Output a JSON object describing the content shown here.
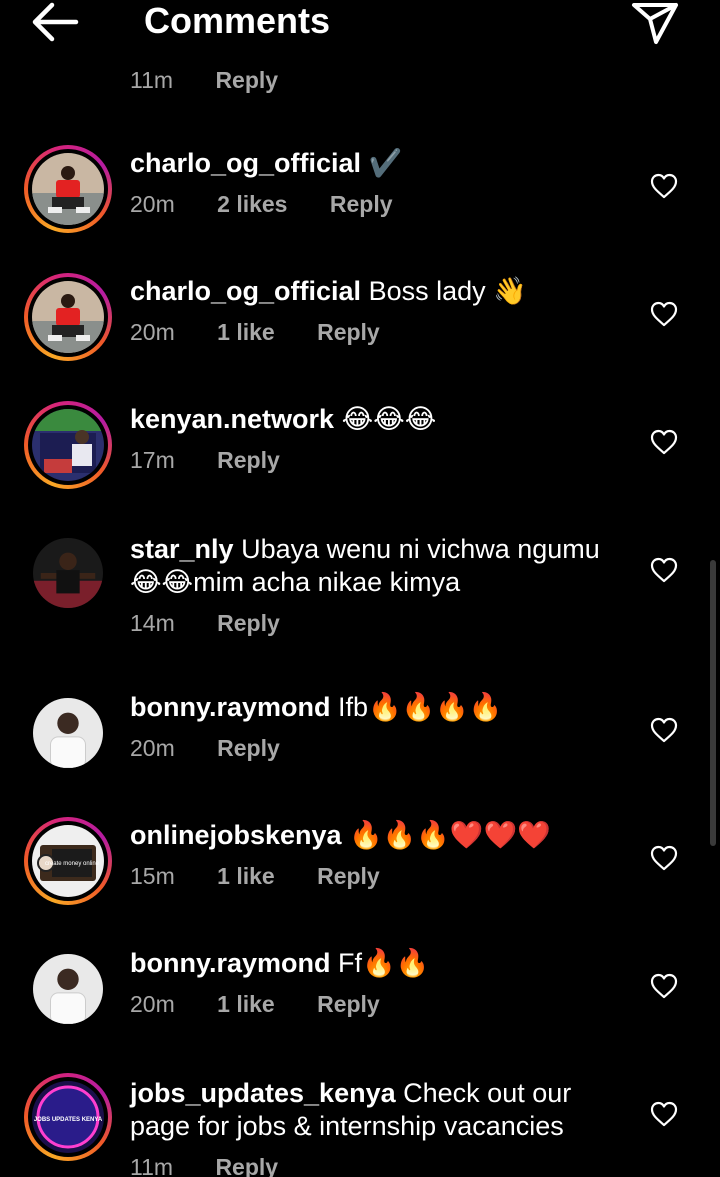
{
  "header": {
    "title": "Comments"
  },
  "top_partial": {
    "time": "11m",
    "reply": "Reply"
  },
  "comments": [
    {
      "username": "charlo_og_official",
      "text": "✔️",
      "time": "20m",
      "likes": "2 likes",
      "reply": "Reply"
    },
    {
      "username": "charlo_og_official",
      "text": "Boss lady 👋",
      "time": "20m",
      "likes": "1 like",
      "reply": "Reply"
    },
    {
      "username": "kenyan.network",
      "text": "😂😂😂",
      "time": "17m",
      "likes": "",
      "reply": "Reply"
    },
    {
      "username": "star_nly",
      "text": "Ubaya wenu ni vichwa  ngumu 😂😂mim acha nikae kimya",
      "time": "14m",
      "likes": "",
      "reply": "Reply"
    },
    {
      "username": "bonny.raymond",
      "text": "Ifb🔥🔥🔥🔥",
      "time": "20m",
      "likes": "",
      "reply": "Reply"
    },
    {
      "username": "onlinejobskenya",
      "text": "🔥🔥🔥❤️❤️❤️",
      "time": "15m",
      "likes": "1 like",
      "reply": "Reply"
    },
    {
      "username": "bonny.raymond",
      "text": "Ff🔥🔥",
      "time": "20m",
      "likes": "1 like",
      "reply": "Reply"
    },
    {
      "username": "jobs_updates_kenya",
      "text": "Check out our page for jobs & internship vacancies",
      "time": "11m",
      "likes": "",
      "reply": "Reply"
    }
  ],
  "avatar_images": {
    "online_money": "create money online",
    "jobs_badge": "JOBS UPDATES KENYA"
  },
  "colors": {
    "background": "#000000",
    "text_primary": "#ffffff",
    "text_secondary": "#a8a8a8",
    "story_ring": [
      "#f9a825",
      "#f05a28",
      "#d6247a",
      "#b51ca1"
    ]
  }
}
